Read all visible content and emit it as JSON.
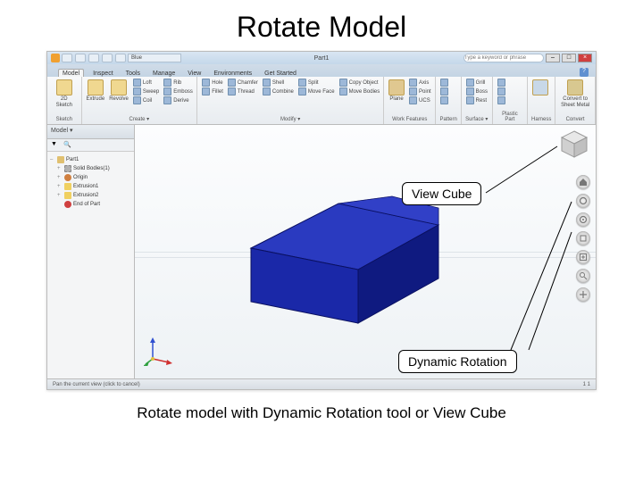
{
  "slide": {
    "title": "Rotate Model",
    "caption": "Rotate model with Dynamic Rotation tool or View Cube"
  },
  "callouts": {
    "view_cube": "View Cube",
    "dynamic_rotation": "Dynamic Rotation"
  },
  "titlebar": {
    "doc_name": "Part1",
    "style": "Blue",
    "search_placeholder": "Type a keyword or phrase"
  },
  "ribbon_tabs": [
    "Model",
    "Inspect",
    "Tools",
    "Manage",
    "View",
    "Environments",
    "Get Started"
  ],
  "ribbon_groups": {
    "sketch": {
      "title": "Sketch",
      "big": [
        "2D Sketch"
      ]
    },
    "create": {
      "title": "Create ▾",
      "big": [
        "Extrude",
        "Revolve"
      ],
      "mini": [
        "Loft",
        "Sweep",
        "Coil",
        "Rib",
        "Emboss",
        "Derive"
      ]
    },
    "modify": {
      "title": "Modify ▾",
      "mini": [
        "Hole",
        "Fillet",
        "Chamfer",
        "Thread",
        "Shell",
        "Combine",
        "Split",
        "Move Face",
        "Copy Object",
        "Move Bodies"
      ]
    },
    "work": {
      "title": "Work Features",
      "big": [
        "Plane"
      ],
      "mini": [
        "Axis",
        "Point",
        "UCS"
      ]
    },
    "pattern": {
      "title": "Pattern",
      "mini": [
        "",
        "",
        ""
      ]
    },
    "surface": {
      "title": "Surface ▾",
      "mini": [
        "Grill",
        "Boss",
        "Rest"
      ]
    },
    "plastic": {
      "title": "Plastic Part",
      "mini": [
        "",
        "",
        ""
      ]
    },
    "harness": {
      "title": "Harness",
      "big": [
        ""
      ]
    },
    "convert": {
      "title": "Convert",
      "big": [
        "Convert to Sheet Metal"
      ]
    }
  },
  "browser": {
    "title": "Model ▾",
    "items": [
      {
        "label": "Part1",
        "cls": "ti-part",
        "indent": 0,
        "caret": "–"
      },
      {
        "label": "Solid Bodies(1)",
        "cls": "ti-solid",
        "indent": 1,
        "caret": "+"
      },
      {
        "label": "Origin",
        "cls": "ti-origin",
        "indent": 1,
        "caret": "+"
      },
      {
        "label": "Extrusion1",
        "cls": "ti-ext",
        "indent": 1,
        "caret": "+"
      },
      {
        "label": "Extrusion2",
        "cls": "ti-ext2",
        "indent": 1,
        "caret": "+"
      },
      {
        "label": "End of Part",
        "cls": "ti-end",
        "indent": 1,
        "caret": ""
      }
    ]
  },
  "status": {
    "left": "Pan the current view (click to cancel)",
    "right": "1   1"
  },
  "nav_tools": [
    "home",
    "orbit",
    "orbit-free",
    "look-at",
    "zoom-all",
    "zoom",
    "pan"
  ]
}
